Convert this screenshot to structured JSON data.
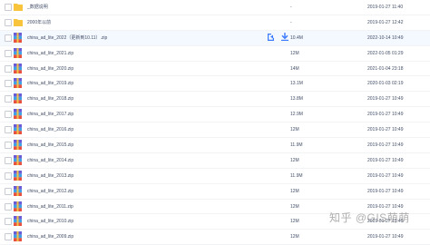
{
  "colors": {
    "accent": "#3b7cff",
    "text": "#424e67",
    "folder": "#f7c43b"
  },
  "rows": [
    {
      "name": "_数据说明",
      "size": "-",
      "date": "2019-01-27 11:40",
      "type": "folder"
    },
    {
      "name": "2000年以前",
      "size": "-",
      "date": "2019-01-27 12:42",
      "type": "folder"
    },
    {
      "name": "china_ad_lite_2022（更新到10.11）.zip",
      "size": "10.4M",
      "date": "2022-10-14 10:49",
      "type": "zip",
      "actions": [
        "share-icon",
        "download-icon"
      ]
    },
    {
      "name": "china_ad_lite_2021.zip",
      "size": "12M",
      "date": "2022-01-05 01:29",
      "type": "zip"
    },
    {
      "name": "china_ad_lite_2020.zip",
      "size": "14M",
      "date": "2021-01-04 23:18",
      "type": "zip"
    },
    {
      "name": "china_ad_lite_2019.zip",
      "size": "13.1M",
      "date": "2020-01-03 02:19",
      "type": "zip"
    },
    {
      "name": "china_ad_lite_2018.zip",
      "size": "13.8M",
      "date": "2019-01-27 10:49",
      "type": "zip"
    },
    {
      "name": "china_ad_lite_2017.zip",
      "size": "12.9M",
      "date": "2019-01-27 10:49",
      "type": "zip"
    },
    {
      "name": "china_ad_lite_2016.zip",
      "size": "12M",
      "date": "2019-01-27 10:49",
      "type": "zip"
    },
    {
      "name": "china_ad_lite_2015.zip",
      "size": "11.9M",
      "date": "2019-01-27 10:49",
      "type": "zip"
    },
    {
      "name": "china_ad_lite_2014.zip",
      "size": "12M",
      "date": "2019-01-27 10:49",
      "type": "zip"
    },
    {
      "name": "china_ad_lite_2013.zip",
      "size": "11.9M",
      "date": "2019-01-27 10:49",
      "type": "zip"
    },
    {
      "name": "china_ad_lite_2012.zip",
      "size": "12M",
      "date": "2019-01-27 10:49",
      "type": "zip"
    },
    {
      "name": "china_ad_lite_2011.zip",
      "size": "12M",
      "date": "2019-01-27 10:49",
      "type": "zip"
    },
    {
      "name": "china_ad_lite_2010.zip",
      "size": "12M",
      "date": "2019-01-27 10:49",
      "type": "zip"
    },
    {
      "name": "china_ad_lite_2009.zip",
      "size": "12M",
      "date": "2019-01-27 10:49",
      "type": "zip"
    }
  ],
  "watermark": "知乎 @GIS萌萌"
}
